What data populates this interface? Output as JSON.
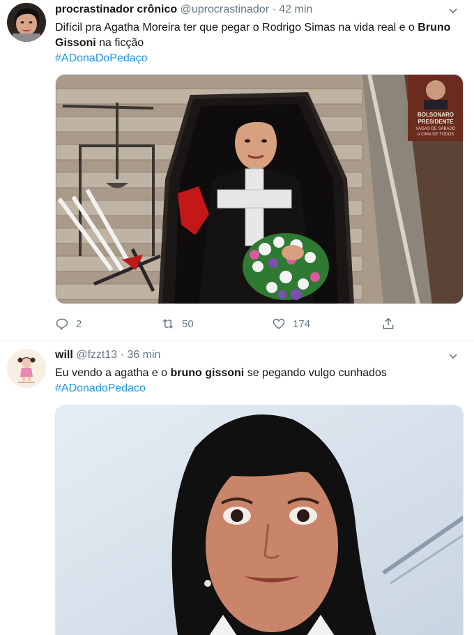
{
  "tweets": [
    {
      "name": "procrastinador crônico",
      "handle": "@uprocrastinador",
      "separator": "·",
      "time": "42 min",
      "text_before": "Difícil pra Agatha Moreira ter que pegar o Rodrigo Simas na vida real e o ",
      "text_bold": "Bruno Gissoni",
      "text_after": " na ficção",
      "hashtag": "#ADonaDoPedaço",
      "poster_lines": [
        "BOLSONARO",
        "PRESIDENTE",
        "VAGAS DE SÁBADO",
        "A CIMA DE TODOS"
      ],
      "actions": {
        "replies": "2",
        "retweets": "50",
        "likes": "174"
      }
    },
    {
      "name": "will",
      "handle": "@fzzt13",
      "separator": "·",
      "time": "36 min",
      "text_before": "Eu vendo a agatha e o ",
      "text_bold": "bruno gissoni",
      "text_after": " se pegando vulgo cunhados",
      "hashtag": "#ADonadoPedaco"
    }
  ],
  "colors": {
    "accent": "#1b95e0",
    "muted": "#657786",
    "text": "#14171a",
    "divider": "#e6ecf0"
  },
  "icons": [
    "reply-icon",
    "retweet-icon",
    "like-icon",
    "share-icon",
    "chevron-down-icon"
  ]
}
